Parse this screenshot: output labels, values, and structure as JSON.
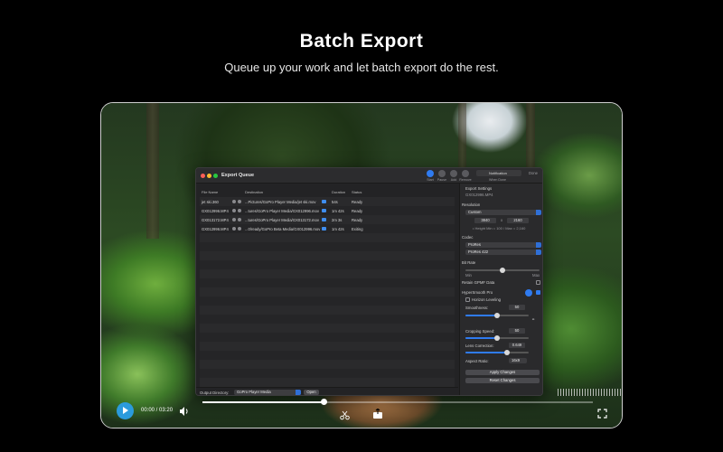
{
  "hero": {
    "title": "Batch Export",
    "subtitle": "Queue up your work and let batch export do the rest."
  },
  "window": {
    "title": "Export Queue",
    "toolbar": {
      "start": "Start",
      "pause": "Pause",
      "add": "Add",
      "remove": "Remove",
      "notification_value": "Notification",
      "when_done": "When Done",
      "done": "Done"
    },
    "queue": {
      "headers": {
        "file_name": "File Name",
        "destination": "Destination",
        "duration": "Duration",
        "status": "Status"
      },
      "rows": [
        {
          "file": "jet ski.360",
          "destination": "...Pictures/GoPro Player Media/jet ski.mov",
          "duration": "54s",
          "status": "Ready"
        },
        {
          "file": "GX012996.MP4",
          "destination": "...tures/GoPro Player Media/GX012996.mov",
          "duration": "1m 42s",
          "status": "Ready"
        },
        {
          "file": "GX013172.MP4",
          "destination": "...tures/GoPro Player Media/GX013172.mov",
          "duration": "2m 3s",
          "status": "Ready"
        },
        {
          "file": "GX012996.MP4",
          "destination": "...0/ready/GoPro Beta Media/GX012996.mov",
          "duration": "1m 42s",
          "status": "Exiting"
        }
      ]
    },
    "output": {
      "label": "Output Directory:",
      "value": "GoPro Player Media",
      "open": "Open"
    },
    "settings": {
      "title": "Export Settings",
      "file": "GX012996.MP4",
      "resolution_label": "Resolution",
      "resolution_value": "Custom",
      "width": "3840",
      "x": "x",
      "height": "2160",
      "resolution_hint": "• Height Min = 100 / Max = 2,160",
      "codec_label": "Codec",
      "codec_value": "ProRes",
      "codec_profile": "ProRes 422",
      "bitrate_label": "Bit Rate",
      "min": "Min",
      "max": "Max",
      "retain_gpmf": "Retain GPMF Data",
      "hypersmooth_label": "HyperSmooth Pro",
      "horizon_leveling": "Horizon Leveling",
      "smoothness_label": "Smoothness:",
      "smoothness_value": "50",
      "smoothness_level": 0.5,
      "cropping_label": "Cropping Speed:",
      "cropping_value": "50",
      "cropping_level": 0.5,
      "lens_label": "Lens Correction:",
      "lens_value": "0.649",
      "lens_level": 0.65,
      "aspect_label": "Aspect Ratio:",
      "aspect_value": "16x9",
      "apply": "Apply Changes",
      "reset": "Reset Changes"
    }
  },
  "player": {
    "time": "00:00 / 03:20",
    "progress": 0.31
  },
  "colors": {
    "accent": "#2b9bdc",
    "window_bg": "#232325",
    "select_blue": "#2f6fd6"
  }
}
